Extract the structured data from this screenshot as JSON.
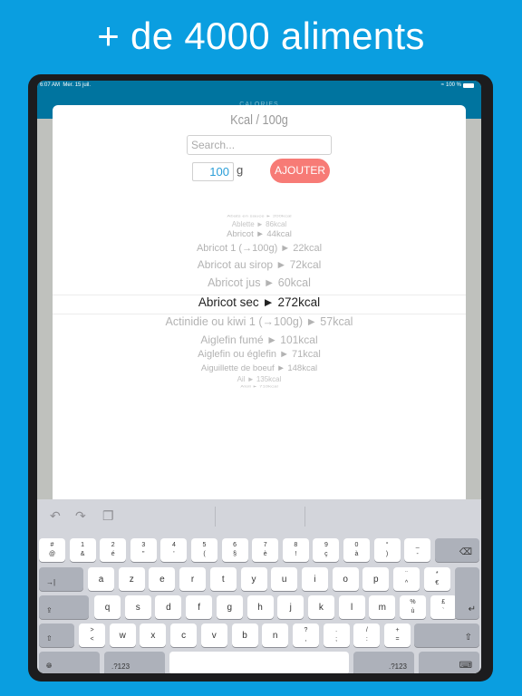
{
  "headline": "+ de 4000 aliments",
  "status_bar": {
    "time": "6:07 AM",
    "date": "Mer. 15 juil.",
    "battery": "100 %"
  },
  "nav_title": "CALORIES",
  "modal": {
    "title": "Kcal / 100g",
    "search_placeholder": "Search...",
    "quantity": "100",
    "unit": "g",
    "add_label": "AJOUTER"
  },
  "picker": {
    "items": [
      "Abats en sauce ► 200kcal",
      "Ablette ► 86kcal",
      "Abricot ► 44kcal",
      "Abricot 1 (→100g) ► 22kcal",
      "Abricot au sirop ► 72kcal",
      "Abricot jus ► 60kcal",
      "Abricot sec ► 272kcal",
      "Actinidie ou kiwi 1 (→100g) ► 57kcal",
      "Aiglefin fumé ► 101kcal",
      "Aiglefin ou églefin ► 71kcal",
      "Aiguillette de boeuf ► 148kcal",
      "Ail ► 135kcal",
      "Aïoli ► 710kcal"
    ],
    "selected_index": 6
  },
  "keyboard": {
    "toolbar": {
      "undo": "undo-icon",
      "redo": "redo-icon",
      "paste": "paste-icon"
    },
    "row1": [
      [
        "#",
        "@"
      ],
      [
        "1",
        "&"
      ],
      [
        "2",
        "é"
      ],
      [
        "3",
        "\""
      ],
      [
        "4",
        "'"
      ],
      [
        "5",
        "("
      ],
      [
        "6",
        "§"
      ],
      [
        "7",
        "è"
      ],
      [
        "8",
        "!"
      ],
      [
        "9",
        "ç"
      ],
      [
        "0",
        "à"
      ],
      [
        "°",
        ")"
      ],
      [
        "_",
        "-"
      ]
    ],
    "row2": [
      "a",
      "z",
      "e",
      "r",
      "t",
      "y",
      "u",
      "i",
      "o",
      "p",
      [
        "¨",
        "^"
      ],
      [
        "*",
        "€"
      ]
    ],
    "row3": [
      "q",
      "s",
      "d",
      "f",
      "g",
      "h",
      "j",
      "k",
      "l",
      "m",
      [
        "%",
        "ù"
      ],
      [
        "£",
        "`"
      ]
    ],
    "row4": [
      [
        ">",
        "<"
      ],
      "w",
      "x",
      "c",
      "v",
      "b",
      "n",
      [
        "?",
        ","
      ],
      [
        ".",
        ";"
      ],
      [
        "/",
        ":"
      ],
      [
        "+",
        "="
      ]
    ],
    "tab_label": "→|",
    "numbers_label": ".?123"
  }
}
